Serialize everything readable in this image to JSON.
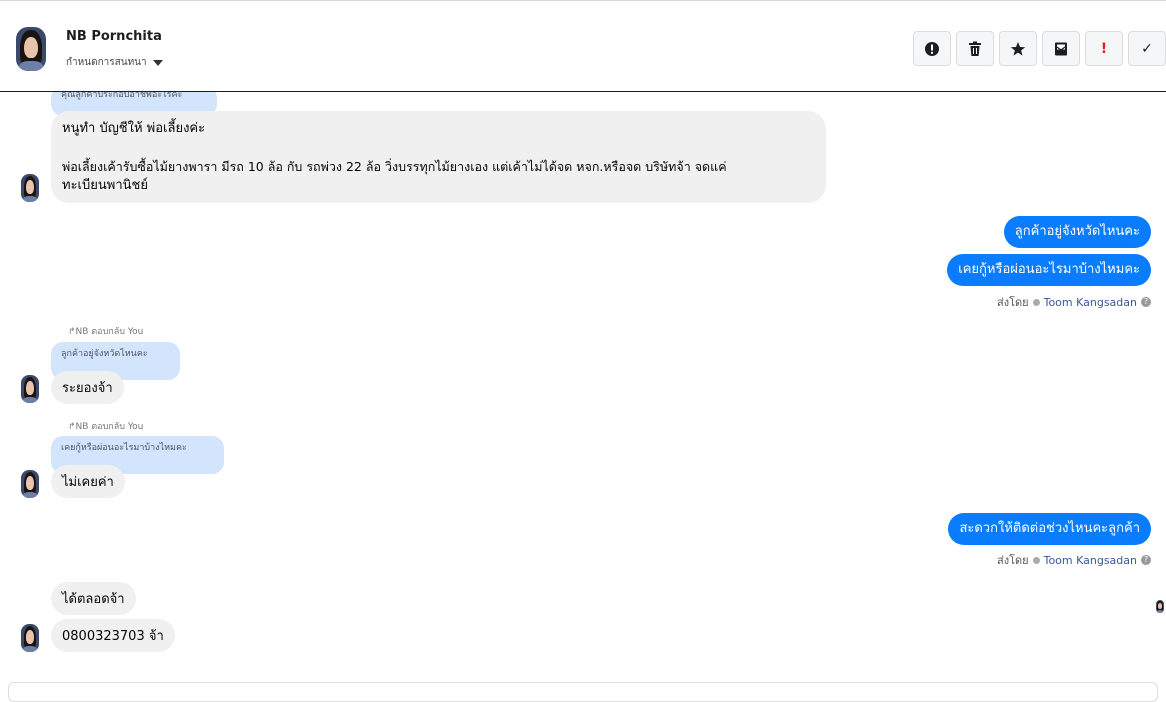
{
  "header": {
    "name": "NB Pornchita",
    "subtitle": "กำหนดการสนทนา"
  },
  "toolbar": {
    "icons": [
      "alert-icon",
      "trash-icon",
      "star-icon",
      "inbox-icon",
      "exclamation-icon",
      "check-icon"
    ],
    "exclamation_glyph": "!",
    "check_glyph": "✓"
  },
  "messages": {
    "top_quote": "คุณลูกค้าประกอบอาชีพอะไรคะ",
    "msg1_line1": "หนูทำ บัญชีให้ พ่อเลี้ยงค่ะ",
    "msg1_line2": "พ่อเลี้ยงเค้ารับซื้อไม้ยางพารา มีรถ 10 ล้อ กับ รถพ่วง 22 ล้อ วิ่งบรรทุกไม้ยางเอง แต่เค้าไม่ได้จด หจก.หรือจด บริษัทจ้า จดแค่",
    "msg1_line3": "ทะเบียนพานิชย์",
    "out1": "ลูกค้าอยู่จังหวัดไหนคะ",
    "out2": "เคยกู้หรือผ่อนอะไรมาบ้างไหมคะ",
    "sent_by_label": "ส่งโดย",
    "sent_by_name": "Toom Kangsadan",
    "reply_tag": "NB ตอบกลับ You",
    "reply1_quote": "ลูกค้าอยู่จังหวัดไหนคะ",
    "reply1": "ระยองจ้า",
    "reply2_quote": "เคยกู้หรือผ่อนอะไรมาบ้างไหมคะ",
    "reply2": "ไม่เคยค่า",
    "out3": "สะดวกให้ติดต่อช่วงไหนคะลูกค้า",
    "last1": "ได้ตลอดจ้า",
    "last2": "0800323703 จ้า"
  }
}
